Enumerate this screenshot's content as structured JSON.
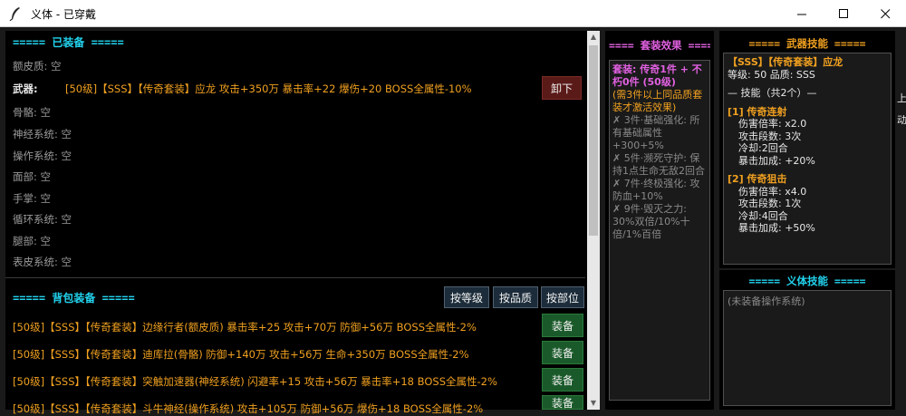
{
  "window": {
    "title": "义体 - 已穿戴",
    "icons": {
      "app": "feather-icon",
      "minimize": "minimize-icon",
      "maximize": "maximize-icon",
      "close": "close-icon"
    }
  },
  "equipped": {
    "title": "===== 已装备 =====",
    "slots": [
      {
        "label": "额皮质: 空"
      },
      {
        "label": "武器:"
      },
      {
        "label": "骨骼: 空"
      },
      {
        "label": "神经系统: 空"
      },
      {
        "label": "操作系统: 空"
      },
      {
        "label": "面部: 空"
      },
      {
        "label": "手掌: 空"
      },
      {
        "label": "循环系统: 空"
      },
      {
        "label": "腿部: 空"
      },
      {
        "label": "表皮系统: 空"
      }
    ],
    "weapon_desc": "[50级]【SSS】【传奇套装】应龙 攻击+350万 暴击率+22 爆伤+20 BOSS全属性-10%",
    "unequip_label": "卸下"
  },
  "bag": {
    "title": "===== 背包装备 =====",
    "sort_buttons": [
      "按等级",
      "按品质",
      "按部位"
    ],
    "items": [
      "[50级]【SSS】【传奇套装】边缘行者(额皮质) 暴击率+25 攻击+70万 防御+56万 BOSS全属性-2%",
      "[50级]【SSS】【传奇套装】迪库拉(骨骼) 防御+140万 攻击+56万 生命+350万 BOSS全属性-2%",
      "[50级]【SSS】【传奇套装】突触加速器(神经系统) 闪避率+15 攻击+56万 暴击率+18 BOSS全属性-2%",
      "[50级]【SSS】【传奇套装】斗牛神经(操作系统) 攻击+105万 防御+56万 爆伤+18 BOSS全属性-2%"
    ],
    "equip_label": "装备"
  },
  "set_effects": {
    "title": "==== 套装效果 ====",
    "header": "套装: 传奇1件 + 不朽0件 (50级)",
    "note": "(需3件以上同品质套装才激活效果)",
    "lines": [
      "✗ 3件·基础强化: 所有基础属性+300+5%",
      "✗ 5件·濒死守护: 保持1点生命无敌2回合",
      "✗ 7件·终极强化: 攻防血+10%",
      "✗ 9件·毁灭之力: 30%双倍/10%十倍/1%百倍"
    ]
  },
  "weapon_skills": {
    "title": "===== 武器技能 =====",
    "weapon_name": "【SSS】【传奇套装】应龙",
    "meta": "等级: 50  品质: SSS",
    "skills_header": "— 技能（共2个）—",
    "skills": [
      {
        "name": "[1] 传奇连射",
        "rate": "伤害倍率: x2.0",
        "hits": "攻击段数: 3次",
        "cooldown": "冷却:2回合",
        "crit": "暴击加成: +20%"
      },
      {
        "name": "[2] 传奇狙击",
        "rate": "伤害倍率: x4.0",
        "hits": "攻击段数: 1次",
        "cooldown": "冷却:4回合",
        "crit": "暴击加成: +50%"
      }
    ]
  },
  "cyber_skills": {
    "title": "===== 义体技能 =====",
    "empty_text": "(未装备操作系统)"
  },
  "edge": {
    "a": "上",
    "b": "动"
  }
}
